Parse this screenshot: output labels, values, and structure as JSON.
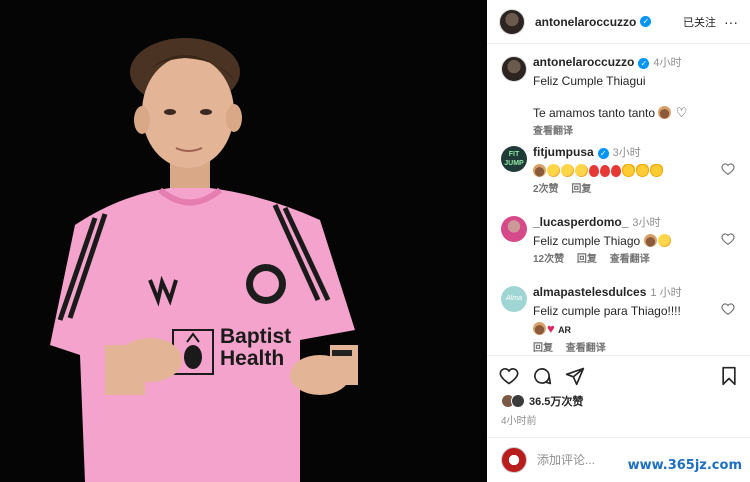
{
  "post": {
    "author": "antonelaroccuzzo",
    "follow_status": "已关注",
    "photo_alt": "boy in pink jersey",
    "jersey_text_line1": "Baptist",
    "jersey_text_line2": "Health"
  },
  "caption": {
    "user": "antonelaroccuzzo",
    "time": "4小时",
    "line1": "Feliz Cumple Thiagui",
    "line2": "Te amamos tanto tanto",
    "translate": "查看翻译"
  },
  "comments": [
    {
      "user": "fitjumpusa",
      "time": "3小时",
      "text": "",
      "likes": "2次赞",
      "reply": "回复",
      "translate": ""
    },
    {
      "user": "_lucasperdomo_",
      "time": "3小时",
      "text": "Feliz cumple Thiago",
      "likes": "12次赞",
      "reply": "回复",
      "translate": "查看翻译"
    },
    {
      "user": "almapastelesdulces",
      "time": "1 小时",
      "text": "Feliz cumple para Thiago!!!!",
      "suffix": "AR",
      "likes": "",
      "reply": "回复",
      "translate": "查看翻译"
    }
  ],
  "stats": {
    "likes": "36.5万次赞",
    "time": "4小时前"
  },
  "compose": {
    "placeholder": "添加评论..."
  },
  "watermark": "www.365jz.com",
  "icons": [
    "heart-icon",
    "comment-icon",
    "share-icon",
    "bookmark-icon",
    "verified-icon"
  ]
}
